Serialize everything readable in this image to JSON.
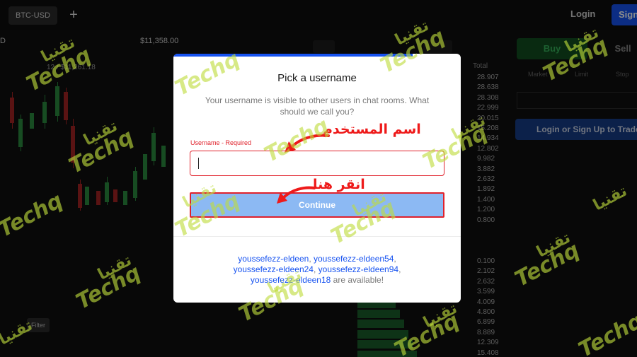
{
  "header": {
    "pair_tab": "BTC-USD",
    "add_tab": "+",
    "login": "Login",
    "signup": "Sign"
  },
  "ticker": {
    "price": "$11,358.00",
    "pair_short": "D",
    "low_fragment": "12 / $11,261.18"
  },
  "modal": {
    "title": "Pick a username",
    "description": "Your username is visible to other users in chat rooms. What should we call you?",
    "field_label": "Username - Required",
    "input_value": "",
    "continue_label": "Continue",
    "suggestions": [
      "youssefezz-eldeen",
      "youssefezz-eldeen54",
      "youssefezz-eldeen24",
      "youssefezz-eldeen94",
      "youssefezz-eldeen18"
    ],
    "suggestion_separator": ", ",
    "suggestions_suffix": " are available!"
  },
  "annotations": {
    "username_label": "اسم المستخدم",
    "click_here": "انقر هنا"
  },
  "trade_panel": {
    "buy": "Buy",
    "sell": "Sell",
    "order_tabs": [
      "Market",
      "Limit",
      "Stop"
    ],
    "login_cta": "Login or Sign Up to Trade"
  },
  "order_book": {
    "header": "Total",
    "totals": [
      "28.907",
      "28.638",
      "28.308",
      "22.999",
      "20.015",
      "15.208",
      "14.934",
      "12.802",
      "9.982",
      "3.882",
      "2.632",
      "1.892",
      "1.400",
      "1.200",
      "0.800"
    ],
    "bid_totals": [
      "0.100",
      "2.102",
      "2.632",
      "3.599",
      "4.009",
      "4.800",
      "6.899",
      "8.889",
      "12.309",
      "15.408"
    ]
  },
  "watermark": {
    "latin": "Techq",
    "arabic": "تقنيا"
  },
  "colors": {
    "accent": "#1652f0",
    "alert": "#e0212b",
    "continue_bg": "#8cb9f3",
    "buy_green": "#35b15a",
    "watermark": "#bedc3c"
  }
}
